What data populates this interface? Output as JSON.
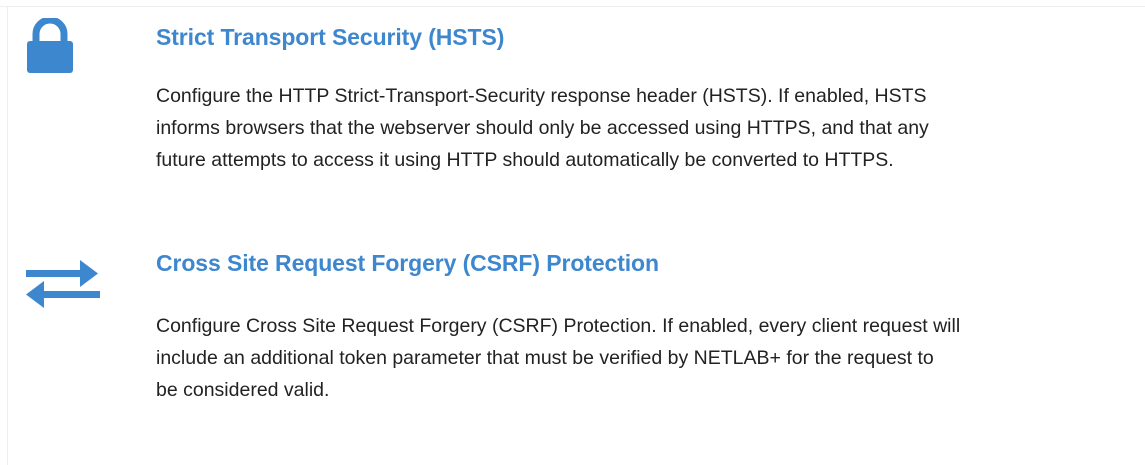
{
  "settings": [
    {
      "icon": "lock-icon",
      "title": "Strict Transport Security (HSTS)",
      "description_lines": [
        "Configure the HTTP Strict-Transport-Security response header (HSTS). If enabled, HSTS",
        "informs browsers that the webserver should only be accessed using HTTPS, and that any",
        "future attempts to access it using HTTP should automatically be converted to HTTPS."
      ]
    },
    {
      "icon": "exchange-arrows-icon",
      "title": "Cross Site Request Forgery (CSRF) Protection",
      "description_lines": [
        "Configure Cross Site Request Forgery (CSRF) Protection. If enabled, every client request will",
        "include an additional token parameter that must be verified by NETLAB+ for the request to",
        "be considered valid."
      ]
    }
  ],
  "colors": {
    "accent": "#3d87cf",
    "text": "#222222",
    "background": "#ffffff"
  }
}
